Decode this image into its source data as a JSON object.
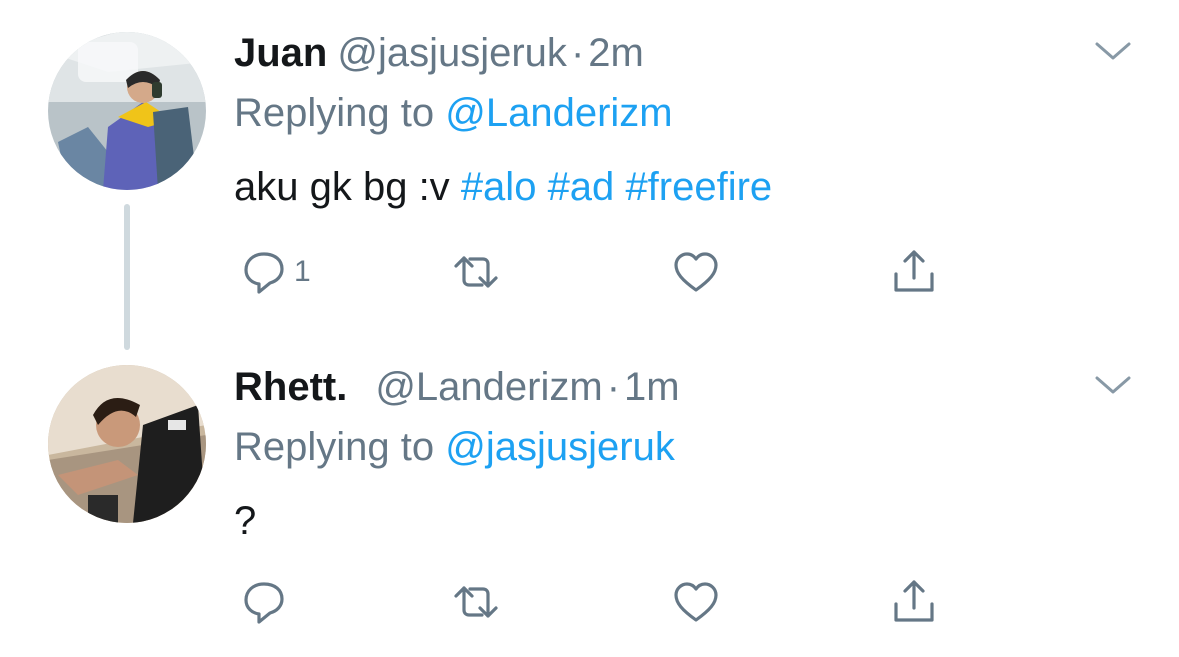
{
  "tweets": [
    {
      "name": "Juan",
      "handle": "@jasjusjeruk",
      "separator": "·",
      "time": "2m",
      "replying_prefix": "Replying to",
      "replying_to": "@Landerizm",
      "text_plain": "aku gk bg :v",
      "hashtags": [
        "#alo",
        "#ad",
        "#freefire"
      ],
      "reply_count": "1"
    },
    {
      "name": "Rhett.",
      "handle": "@Landerizm",
      "separator": "·",
      "time": "1m",
      "replying_prefix": "Replying to",
      "replying_to": "@jasjusjeruk",
      "text_plain": "?",
      "reply_count": ""
    }
  ],
  "icons": {
    "reply": "reply-icon",
    "retweet": "retweet-icon",
    "like": "heart-icon",
    "share": "share-icon",
    "menu": "chevron-down-icon"
  },
  "colors": {
    "link": "#1da1f2",
    "secondary": "#657786",
    "primary_text": "#14171a",
    "thread_line": "#cfd9de"
  }
}
